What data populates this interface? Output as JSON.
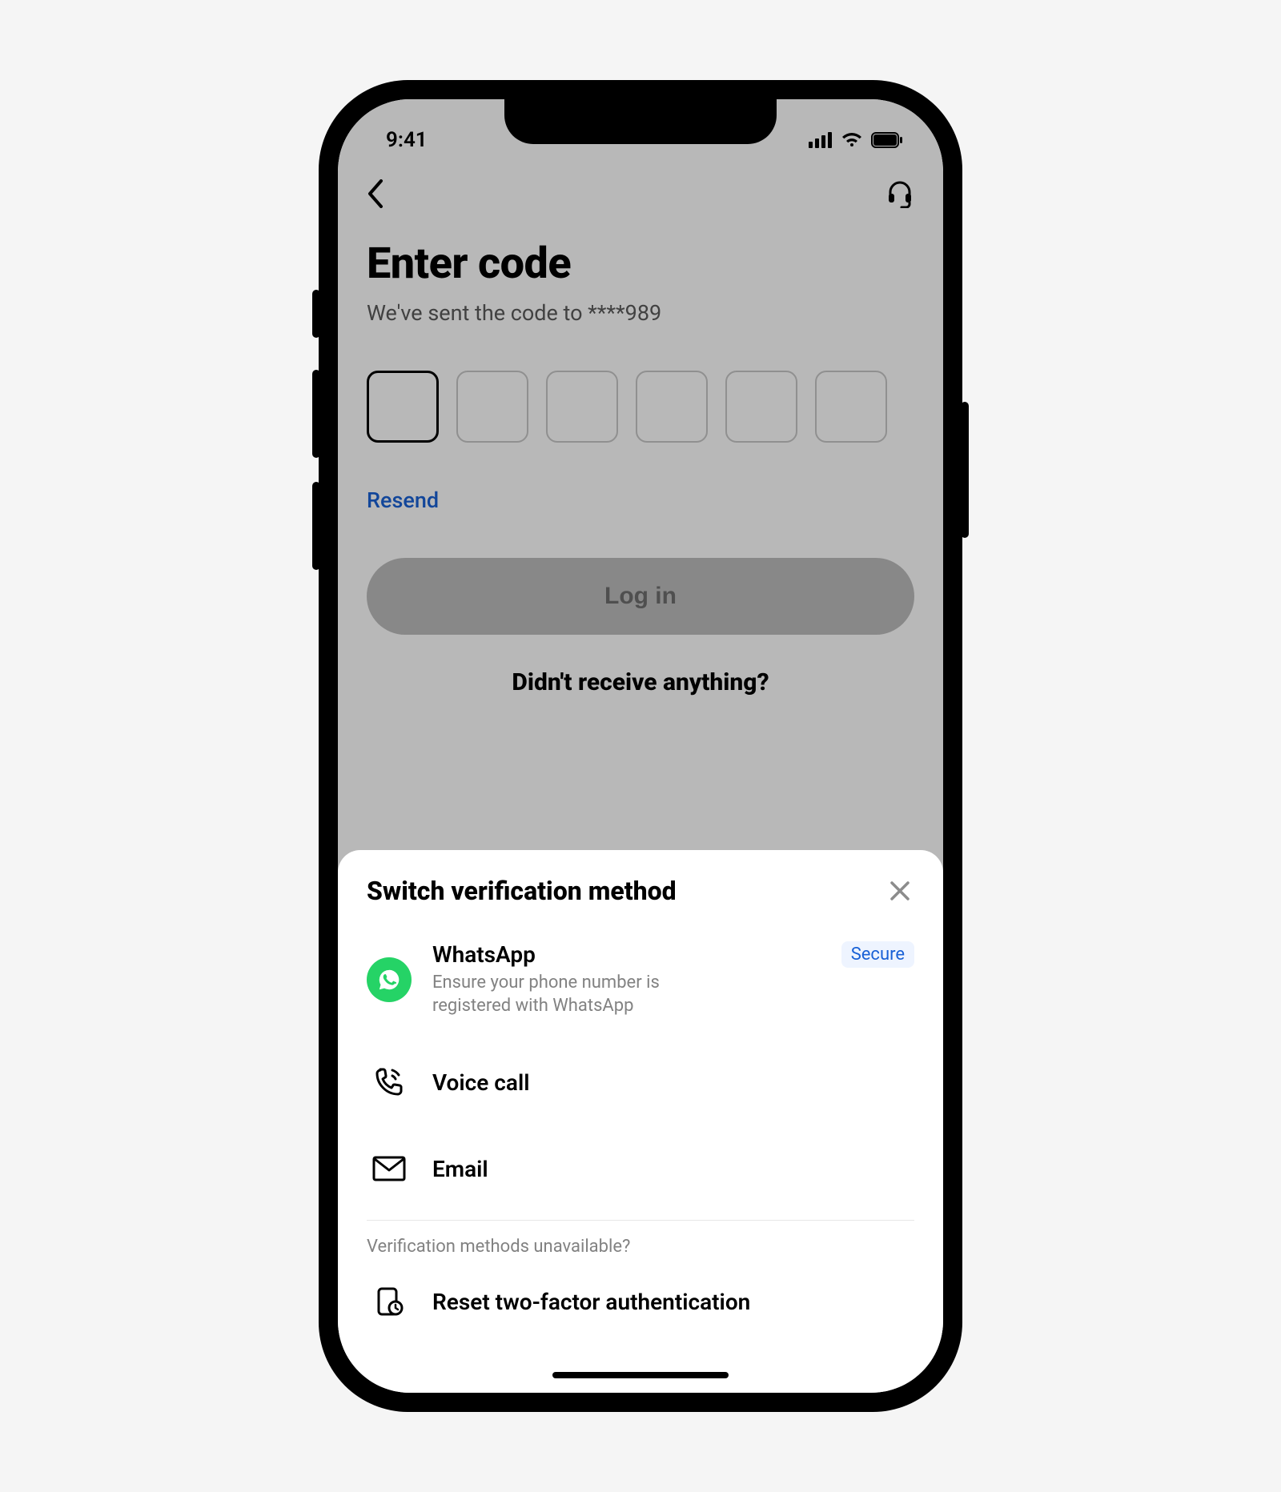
{
  "status": {
    "time": "9:41"
  },
  "page": {
    "title": "Enter code",
    "subtitle": "We've sent the code to ****989",
    "resend": "Resend",
    "login_label": "Log in",
    "not_received": "Didn't receive anything?"
  },
  "sheet": {
    "title": "Switch verification method",
    "secure_badge": "Secure",
    "methods": {
      "whatsapp": {
        "title": "WhatsApp",
        "desc": "Ensure your phone number is registered with WhatsApp"
      },
      "voice": {
        "title": "Voice call"
      },
      "email": {
        "title": "Email"
      }
    },
    "unavailable_label": "Verification methods unavailable?",
    "reset_label": "Reset two-factor authentication"
  }
}
